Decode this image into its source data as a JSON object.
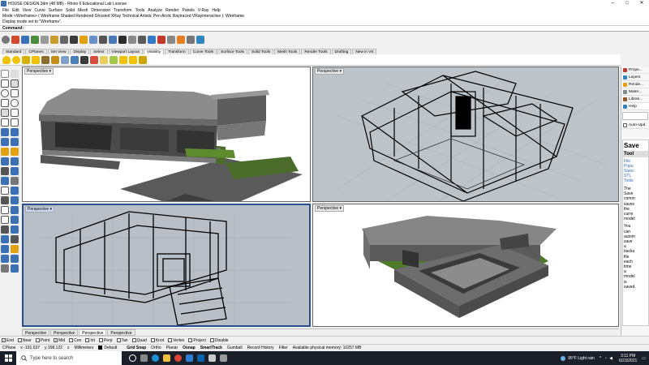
{
  "window": {
    "title": "HOUSE DESIGN.3dm (48 MB) - Rhino 6 Educational Lab License",
    "controls": [
      "–",
      "□",
      "✕"
    ]
  },
  "menu": [
    "File",
    "Edit",
    "View",
    "Curve",
    "Surface",
    "Solid",
    "Mesh",
    "Dimension",
    "Transform",
    "Tools",
    "Analyze",
    "Render",
    "Panels",
    "V-Ray",
    "Help"
  ],
  "command_history": [
    "Mode <Wireframe> ( Wireframe  Shaded  Rendered  Ghosted  XRay  Technical  Artistic  Pen  Arctic  Raytraced  VRayInteractive ): Wireframe",
    "Display mode set to \"Wireframe\"."
  ],
  "command_prompt": "Command:",
  "ribbon_tabs": [
    "Standard",
    "CPlanes",
    "Set View",
    "Display",
    "Select",
    "Viewport Layout",
    "Visibility",
    "Transform",
    "Curve Tools",
    "Surface Tools",
    "Solid Tools",
    "Mesh Tools",
    "Render Tools",
    "Drafting",
    "New in V6"
  ],
  "active_ribbon_tab": "Visibility",
  "viewports": [
    {
      "label": "Perspective ▾",
      "mode": "rendered"
    },
    {
      "label": "Perspective ▾",
      "mode": "wireframe"
    },
    {
      "label": "Perspective ▾",
      "mode": "wireframe",
      "active": true
    },
    {
      "label": "Perspective ▾",
      "mode": "rendered"
    }
  ],
  "viewport_tabs": [
    "Perspective",
    "Perspective",
    "Perspective",
    "Perspective"
  ],
  "osnaps": [
    {
      "label": "End",
      "checked": true
    },
    {
      "label": "Near",
      "checked": false
    },
    {
      "label": "Point",
      "checked": false
    },
    {
      "label": "Mid",
      "checked": true
    },
    {
      "label": "Cen",
      "checked": false
    },
    {
      "label": "Int",
      "checked": false
    },
    {
      "label": "Perp",
      "checked": false
    },
    {
      "label": "Tan",
      "checked": false
    },
    {
      "label": "Quad",
      "checked": false
    },
    {
      "label": "Knot",
      "checked": false
    },
    {
      "label": "Vertex",
      "checked": false
    },
    {
      "label": "Project",
      "checked": false
    },
    {
      "label": "Disable",
      "checked": false
    }
  ],
  "status": {
    "cplane": "CPlane",
    "x": "x -191.637",
    "y": "y 398.122",
    "z": "z",
    "units": "Millimeters",
    "layer": "Default",
    "grid_snap": "Grid Snap",
    "ortho": "Ortho",
    "planar": "Planar",
    "osnap": "Osnap",
    "smarttrack": "SmartTrack",
    "gumball": "Gumball",
    "record_history": "Record History",
    "filter": "Filter",
    "memory": "Available physical memory: 10257 MB"
  },
  "right_panel": {
    "tabs": [
      {
        "label": "Prope...",
        "color": "#c0392b"
      },
      {
        "label": "Layers",
        "color": "#2e86c1"
      },
      {
        "label": "Rende...",
        "color": "#f39c12"
      },
      {
        "label": "Mater...",
        "color": "#7f8c8d"
      },
      {
        "label": "Librari...",
        "color": "#8e5a2b"
      },
      {
        "label": "Help",
        "color": "#2e86c1"
      }
    ],
    "auto_update": "Auto-Upd",
    "help_title": "Save",
    "help_subtitle": "Tool",
    "help_links": [
      "File",
      "Popu",
      "Stanc",
      "STL",
      "Tools"
    ],
    "help_text": [
      "The",
      "Save",
      "comm",
      "saves",
      "the",
      "curre",
      "model",
      "You",
      "can",
      "autom",
      "save",
      "a",
      "backu",
      "file",
      "each",
      "time",
      "a",
      "model",
      "is",
      "saved."
    ]
  },
  "taskbar": {
    "search_placeholder": "Type here to search",
    "weather": "95°F  Light rain",
    "time": "3:11 PM",
    "date": "6/23/2021"
  }
}
